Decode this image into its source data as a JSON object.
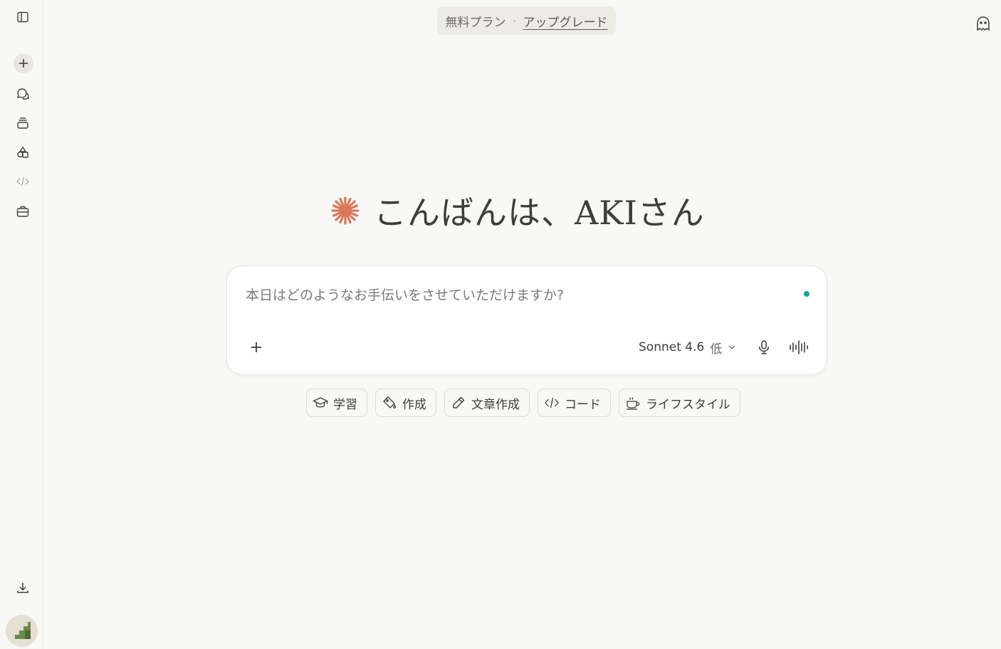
{
  "sidebar": {
    "items": [
      {
        "icon": "sidebar-toggle-icon"
      },
      {
        "icon": "plus-icon"
      },
      {
        "icon": "chats-icon"
      },
      {
        "icon": "projects-icon"
      },
      {
        "icon": "artifacts-icon"
      },
      {
        "icon": "code-icon"
      },
      {
        "icon": "briefcase-icon"
      }
    ],
    "download_icon": "download-icon",
    "avatar_icon": "avatar-stairs-icon"
  },
  "header": {
    "plan_label": "無料プラン",
    "separator": "・",
    "upgrade_label": "アップグレード",
    "ghost_icon": "ghost-icon"
  },
  "greeting": {
    "text": "こんばんは、AKIさん",
    "logo_color": "#d97757"
  },
  "composer": {
    "placeholder": "本日はどのようなお手伝いをさせていただけますか?",
    "model": "Sonnet 4.6",
    "effort": "低",
    "status_color": "#1aa39a"
  },
  "chips": [
    {
      "label": "学習",
      "icon": "graduation-cap-icon"
    },
    {
      "label": "作成",
      "icon": "paint-bucket-icon"
    },
    {
      "label": "文章作成",
      "icon": "pencil-icon"
    },
    {
      "label": "コード",
      "icon": "code-icon"
    },
    {
      "label": "ライフスタイル",
      "icon": "coffee-cup-icon"
    }
  ]
}
